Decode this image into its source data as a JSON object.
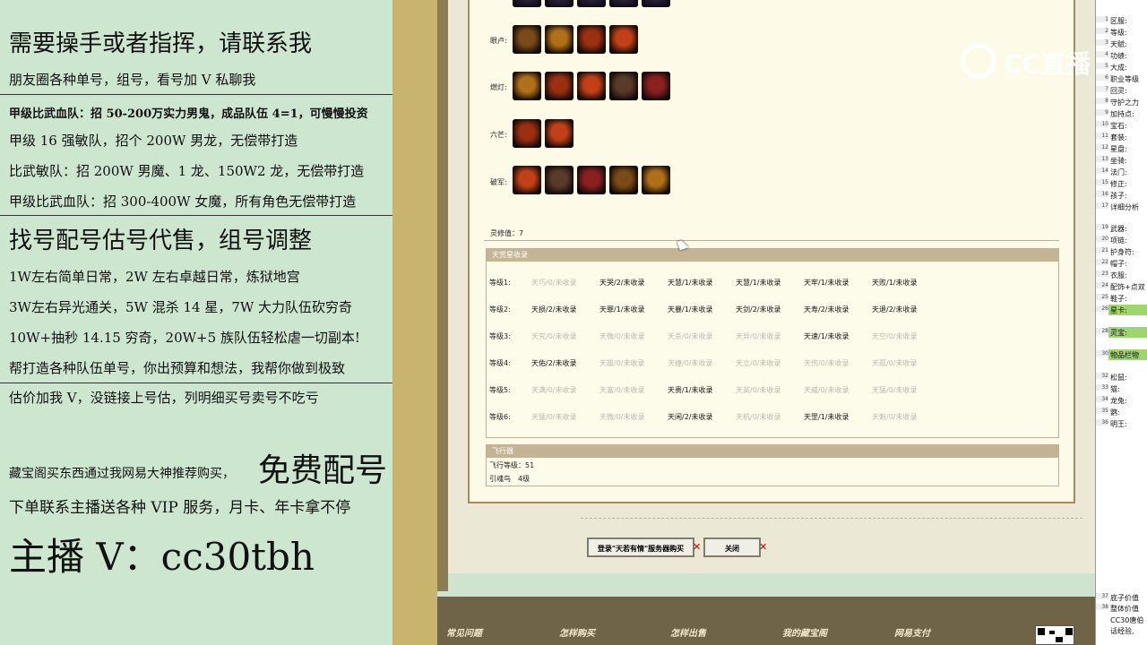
{
  "promo": {
    "line1": "需要操手或者指挥，请联系我",
    "line2": "朋友圈各种单号，组号，看号加 V 私聊我",
    "line3": "甲级比武血队：招 50-200万实力男鬼，成品队伍 4=1，可慢慢投资",
    "line4": "甲级 16 强敏队，招个 200W 男龙，无偿带打造",
    "line5": "比武敏队：招 200W 男魔、1 龙、150W2 龙，无偿带打造",
    "line6": "甲级比武血队：招 300-400W 女魔，所有角色无偿带打造",
    "line7": "找号配号估号代售，组号调整",
    "line8": "1W左右简单日常，2W 左右卓越日常，炼狱地宫",
    "line9": "3W左右异光通关，5W 混杀 14 星，7W 大力队伍砍穷奇",
    "line10": "10W+抽秒 14.15 穷奇，20W+5 族队伍轻松虐一切副本!",
    "line11": "帮打造各种队伍单号，你出预算和想法，我帮你做到极致",
    "line12": "估价加我 V，没链接上号估，列明细买号卖号不吃亏",
    "line13a": "藏宝阁买东西通过我网易大神推荐购买，",
    "line13b": "免费配号",
    "line14": "下单联系主播送各种 VIP 服务，月卡、年卡拿不停",
    "line15": "主播 V：cc30tbh"
  },
  "equip_rows": [
    {
      "label": "眼卢:",
      "count": 4
    },
    {
      "label": "燃灯:",
      "count": 5
    },
    {
      "label": "六芒:",
      "count": 2
    },
    {
      "label": "破军:",
      "count": 5
    }
  ],
  "lingxiu": "灵修值：7",
  "tianyin": {
    "title": "天赏星收录",
    "rows": [
      {
        "level": "等级1:",
        "cells": [
          {
            "t": "天巧/0/未收录",
            "on": false
          },
          {
            "t": "天哭/2/未收录",
            "on": true
          },
          {
            "t": "天慧/1/未收录",
            "on": true
          },
          {
            "t": "天慧/1/未收录",
            "on": true
          },
          {
            "t": "天牢/1/未收录",
            "on": true
          },
          {
            "t": "天败/1/未收录",
            "on": true
          }
        ]
      },
      {
        "level": "等级2:",
        "cells": [
          {
            "t": "天损/2/未收录",
            "on": true
          },
          {
            "t": "天罪/1/未收录",
            "on": true
          },
          {
            "t": "天暴/1/未收录",
            "on": true
          },
          {
            "t": "天剑/2/未收录",
            "on": true
          },
          {
            "t": "天寿/2/未收录",
            "on": true
          },
          {
            "t": "天退/2/未收录",
            "on": true
          }
        ]
      },
      {
        "level": "等级3:",
        "cells": [
          {
            "t": "天究/0/未收录",
            "on": false
          },
          {
            "t": "天微/0/未收录",
            "on": false
          },
          {
            "t": "天杀/0/未收录",
            "on": false
          },
          {
            "t": "天异/0/未收录",
            "on": false
          },
          {
            "t": "天速/1/未收录",
            "on": true
          },
          {
            "t": "天空/0/未收录",
            "on": false
          }
        ]
      },
      {
        "level": "等级4:",
        "cells": [
          {
            "t": "天佑/2/未收录",
            "on": true
          },
          {
            "t": "天雄/0/未收录",
            "on": false
          },
          {
            "t": "天捷/0/未收录",
            "on": false
          },
          {
            "t": "天立/0/未收录",
            "on": false
          },
          {
            "t": "天伤/0/未收录",
            "on": false
          },
          {
            "t": "天孤/0/未收录",
            "on": false
          }
        ]
      },
      {
        "level": "等级5:",
        "cells": [
          {
            "t": "天满/0/未收录",
            "on": false
          },
          {
            "t": "天富/0/未收录",
            "on": false
          },
          {
            "t": "天贵/1/未收录",
            "on": true
          },
          {
            "t": "天英/0/未收录",
            "on": false
          },
          {
            "t": "天威/0/未收录",
            "on": false
          },
          {
            "t": "天猛/0/未收录",
            "on": false
          }
        ]
      },
      {
        "level": "等级6:",
        "cells": [
          {
            "t": "天猛/0/未收录",
            "on": false
          },
          {
            "t": "天微/0/未收录",
            "on": false
          },
          {
            "t": "天闲/2/未收录",
            "on": true
          },
          {
            "t": "天机/0/未收录",
            "on": false
          },
          {
            "t": "天罡/1/未收录",
            "on": true
          },
          {
            "t": "天魁/0/未收录",
            "on": false
          }
        ]
      }
    ]
  },
  "flight": {
    "title": "飞行器",
    "level": "飞行等级：51",
    "bird": "引魂鸟　4级"
  },
  "buttons": {
    "login": "登录\"天若有情\"服务器购买",
    "close": "关闭"
  },
  "bottom_nav": [
    "常见问题",
    "怎样购买",
    "怎样出售",
    "我的藏宝阁",
    "网易支付"
  ],
  "logo_text": "CC直播",
  "sheet": {
    "rows": [
      {
        "n": "1",
        "t": "区服:"
      },
      {
        "n": "2",
        "t": "等级:"
      },
      {
        "n": "3",
        "t": "天赋:"
      },
      {
        "n": "4",
        "t": "功绩:"
      },
      {
        "n": "5",
        "t": "大成:"
      },
      {
        "n": "6",
        "t": "职业等级"
      },
      {
        "n": "7",
        "t": "回灵:"
      },
      {
        "n": "8",
        "t": "守护之力"
      },
      {
        "n": "9",
        "t": "加持点:"
      },
      {
        "n": "10",
        "t": "宝石:"
      },
      {
        "n": "11",
        "t": "套装:"
      },
      {
        "n": "12",
        "t": "星盘:"
      },
      {
        "n": "13",
        "t": "坐骑:"
      },
      {
        "n": "14",
        "t": "法门:"
      },
      {
        "n": "15",
        "t": "修正:"
      },
      {
        "n": "16",
        "t": "孩子:"
      },
      {
        "n": "17",
        "t": "详细分析"
      },
      {
        "n": "19",
        "t": "武器:"
      },
      {
        "n": "20",
        "t": "项链:"
      },
      {
        "n": "21",
        "t": "护身符:"
      },
      {
        "n": "22",
        "t": "帽子:"
      },
      {
        "n": "23",
        "t": "衣服:"
      },
      {
        "n": "24",
        "t": "配饰+点双"
      },
      {
        "n": "25",
        "t": "鞋子:"
      },
      {
        "n": "26",
        "t": "星卡:"
      },
      {
        "n": "28",
        "t": "灵宝:"
      },
      {
        "n": "30",
        "t": "物品栏物"
      },
      {
        "n": "32",
        "t": "松鼠:"
      },
      {
        "n": "33",
        "t": "猫:"
      },
      {
        "n": "34",
        "t": "龙兔:"
      },
      {
        "n": "35",
        "t": "鹦:"
      },
      {
        "n": "36",
        "t": "明王:"
      },
      {
        "n": "37",
        "t": "底子价值"
      },
      {
        "n": "38",
        "t": "整体价值"
      },
      {
        "n": "",
        "t": "CC30唐伯"
      },
      {
        "n": "",
        "t": "话经验,"
      }
    ]
  }
}
